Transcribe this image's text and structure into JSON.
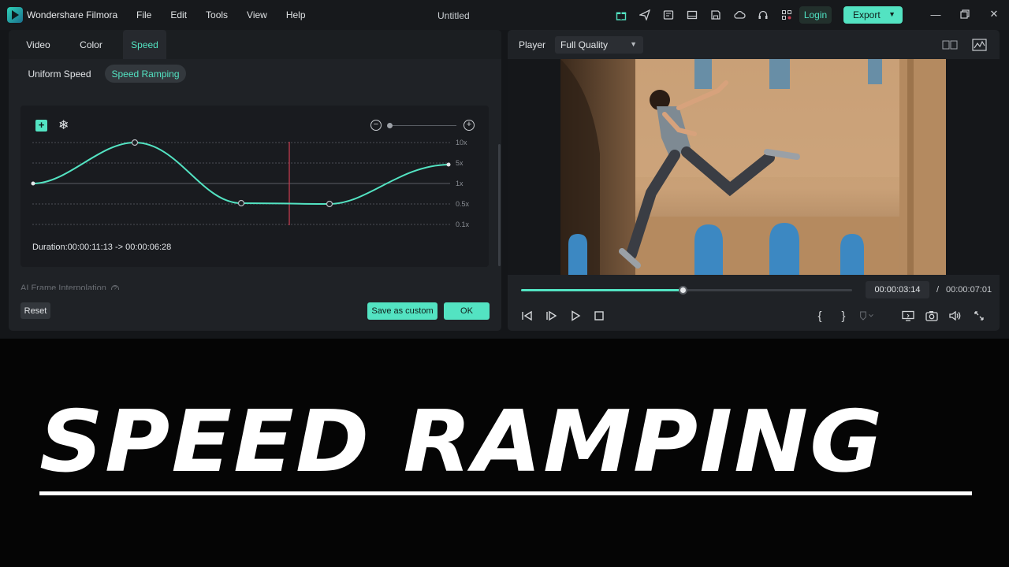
{
  "app": {
    "name": "Wondershare Filmora",
    "menu": [
      "File",
      "Edit",
      "Tools",
      "View",
      "Help"
    ],
    "document_title": "Untitled",
    "toolbar_icons": [
      "gift-icon",
      "send-icon",
      "news-icon",
      "layout-icon",
      "save-icon",
      "cloud-icon",
      "headset-icon",
      "grid-icon"
    ],
    "login_label": "Login",
    "export_label": "Export",
    "window_controls": [
      "minimize-icon",
      "restore-icon",
      "close-icon"
    ]
  },
  "editor": {
    "tabs": [
      {
        "label": "Video",
        "active": false
      },
      {
        "label": "Color",
        "active": false
      },
      {
        "label": "Speed",
        "active": true
      }
    ],
    "subtabs": [
      {
        "label": "Uniform Speed",
        "active": false
      },
      {
        "label": "Speed Ramping",
        "active": true
      }
    ],
    "speed_levels": [
      "10x",
      "5x",
      "1x",
      "0.5x",
      "0.1x"
    ],
    "duration_text": "Duration:00:00:11:13 -> 00:00:06:28",
    "ai_frame_label": "AI Frame Interpolation",
    "reset_label": "Reset",
    "save_custom_label": "Save as custom",
    "ok_label": "OK",
    "accent_color": "#53e3c2",
    "playhead_color": "#c23b4e"
  },
  "player": {
    "label": "Player",
    "quality": "Full Quality",
    "current_time": "00:00:03:14",
    "separator": "/",
    "total_time": "00:00:07:01",
    "progress_fraction": 0.49,
    "controls": [
      "prev-frame-icon",
      "next-frame-icon",
      "play-icon",
      "stop-icon"
    ],
    "right_controls": [
      "mark-in-icon",
      "mark-out-icon",
      "marker-icon",
      "display-icon",
      "snapshot-icon",
      "volume-icon",
      "fullscreen-icon"
    ]
  },
  "banner": {
    "title": "SPEED RAMPING"
  }
}
